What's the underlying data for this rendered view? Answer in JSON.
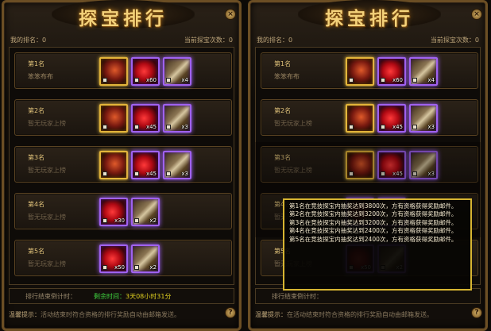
{
  "title": "探宝排行",
  "my_rank_label": "我的排名：0",
  "my_count_label": "当前探宝次数：0",
  "ranks": [
    {
      "title": "第1名",
      "player": "笨笨布布",
      "items": [
        {
          "icon": "helmet-icon",
          "frame": "gold",
          "qty": ""
        },
        {
          "icon": "red-gem-icon",
          "frame": "purple",
          "qty": "x60"
        },
        {
          "icon": "treasure-chest-icon",
          "frame": "purple",
          "qty": "x4"
        }
      ]
    },
    {
      "title": "第2名",
      "player": "暂无玩家上榜",
      "items": [
        {
          "icon": "helmet-icon",
          "frame": "gold",
          "qty": ""
        },
        {
          "icon": "red-gem-icon",
          "frame": "purple",
          "qty": "x45"
        },
        {
          "icon": "treasure-chest-icon",
          "frame": "purple",
          "qty": "x3"
        }
      ]
    },
    {
      "title": "第3名",
      "player": "暂无玩家上榜",
      "items": [
        {
          "icon": "helmet-icon",
          "frame": "gold",
          "qty": ""
        },
        {
          "icon": "red-gem-icon",
          "frame": "purple",
          "qty": "x45"
        },
        {
          "icon": "treasure-chest-icon",
          "frame": "purple",
          "qty": "x3"
        }
      ]
    },
    {
      "title": "第4名",
      "player": "暂无玩家上榜",
      "items": [
        {
          "icon": "red-gem-icon",
          "frame": "purple",
          "qty": "x30"
        },
        {
          "icon": "treasure-chest-icon",
          "frame": "purple",
          "qty": "x2"
        }
      ]
    },
    {
      "title": "第5名",
      "player": "暂无玩家上榜",
      "items": [
        {
          "icon": "red-gem-icon",
          "frame": "purple",
          "qty": "x50"
        },
        {
          "icon": "treasure-chest-icon",
          "frame": "purple",
          "qty": "x2"
        }
      ]
    }
  ],
  "countdown_label": "排行结束倒计时：",
  "countdown_prefix": "剩余时间：",
  "countdown_value": "3天08小时31分",
  "tip_label": "温馨提示：",
  "tip_text": "活动结束时符合资格的排行奖励自动由邮箱发送。",
  "tip_text_right": "在活动结束时符合资格的排行奖励自动由邮箱发送。",
  "tooltip_lines": [
    "第1名在竞技探宝内抽奖达到3800次，方有资格获得奖励邮件。",
    "第2名在竞技探宝内抽奖达到3200次，方有资格获得奖励邮件。",
    "第3名在竞技探宝内抽奖达到3200次，方有资格获得奖励邮件。",
    "第4名在竞技探宝内抽奖达到2400次，方有资格获得奖励邮件。",
    "第5名在竞技探宝内抽奖达到2400次，方有资格获得奖励邮件。"
  ],
  "close_glyph": "×",
  "help_glyph": "?",
  "colors": {
    "accent": "#f4d27a",
    "frame_gold": "#e3b53a",
    "frame_purple": "#a062f0",
    "tooltip_border": "#d7b531",
    "timer_green": "#3fd23f"
  }
}
